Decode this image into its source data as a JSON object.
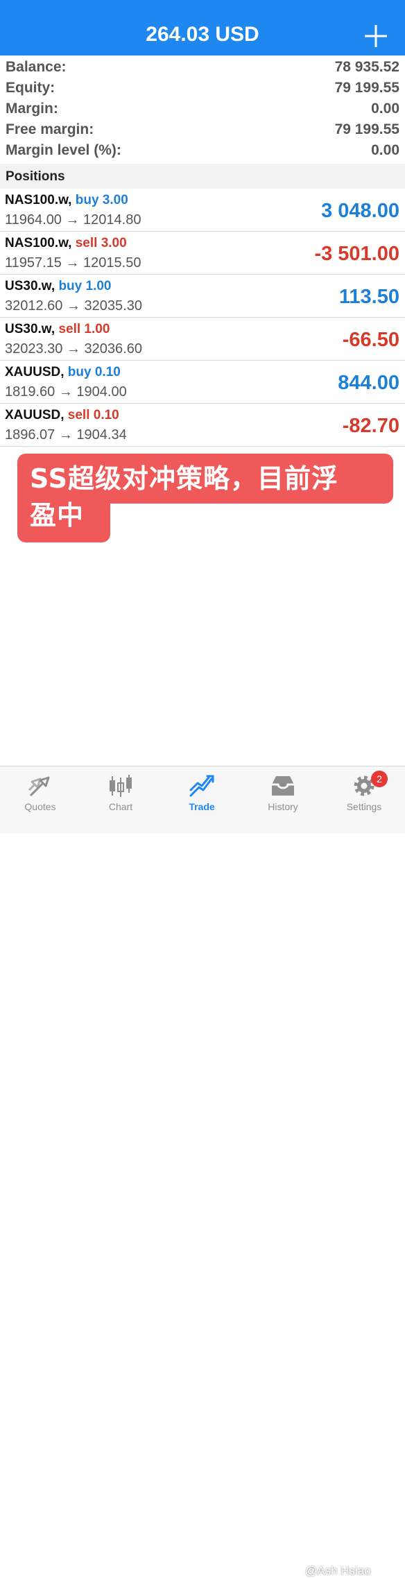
{
  "header": {
    "title": "264.03 USD",
    "add_icon": "plus-icon"
  },
  "summary": [
    {
      "label": "Balance:",
      "value": "78 935.52"
    },
    {
      "label": "Equity:",
      "value": "79 199.55"
    },
    {
      "label": "Margin:",
      "value": "0.00"
    },
    {
      "label": "Free margin:",
      "value": "79 199.55"
    },
    {
      "label": "Margin level (%):",
      "value": "0.00"
    }
  ],
  "positions": {
    "title": "Positions",
    "items": [
      {
        "symbol": "NAS100.w,",
        "side": "buy 3.00",
        "prices": "11964.00 → 12014.80",
        "profit": "3 048.00"
      },
      {
        "symbol": "NAS100.w,",
        "side": "sell 3.00",
        "prices": "11957.15 → 12015.50",
        "profit": "-3 501.00"
      },
      {
        "symbol": "US30.w,",
        "side": "buy 1.00",
        "prices": "32012.60 → 32035.30",
        "profit": "113.50"
      },
      {
        "symbol": "US30.w,",
        "side": "sell 1.00",
        "prices": "32023.30 → 32036.60",
        "profit": "-66.50"
      },
      {
        "symbol": "XAUUSD,",
        "side": "buy 0.10",
        "prices": "1819.60 → 1904.00",
        "profit": "844.00"
      },
      {
        "symbol": "XAUUSD,",
        "side": "sell 0.10",
        "prices": "1896.07 → 1904.34",
        "profit": "-82.70"
      }
    ]
  },
  "banner": {
    "line1": "SS超级对冲策略，目前浮",
    "line2": "盈中",
    "color": "#f0595a"
  },
  "tabs": [
    {
      "label": "Quotes",
      "icon": "quotes-icon"
    },
    {
      "label": "Chart",
      "icon": "chart-icon"
    },
    {
      "label": "Trade",
      "icon": "trade-icon",
      "active": true
    },
    {
      "label": "History",
      "icon": "history-icon"
    },
    {
      "label": "Settings",
      "icon": "gear-icon",
      "badge": "2"
    }
  ],
  "watermark": "@Ash Hsiao",
  "colors": {
    "accent": "#1e88f0",
    "buy": "#1e7fd6",
    "sell": "#d63a2a"
  }
}
